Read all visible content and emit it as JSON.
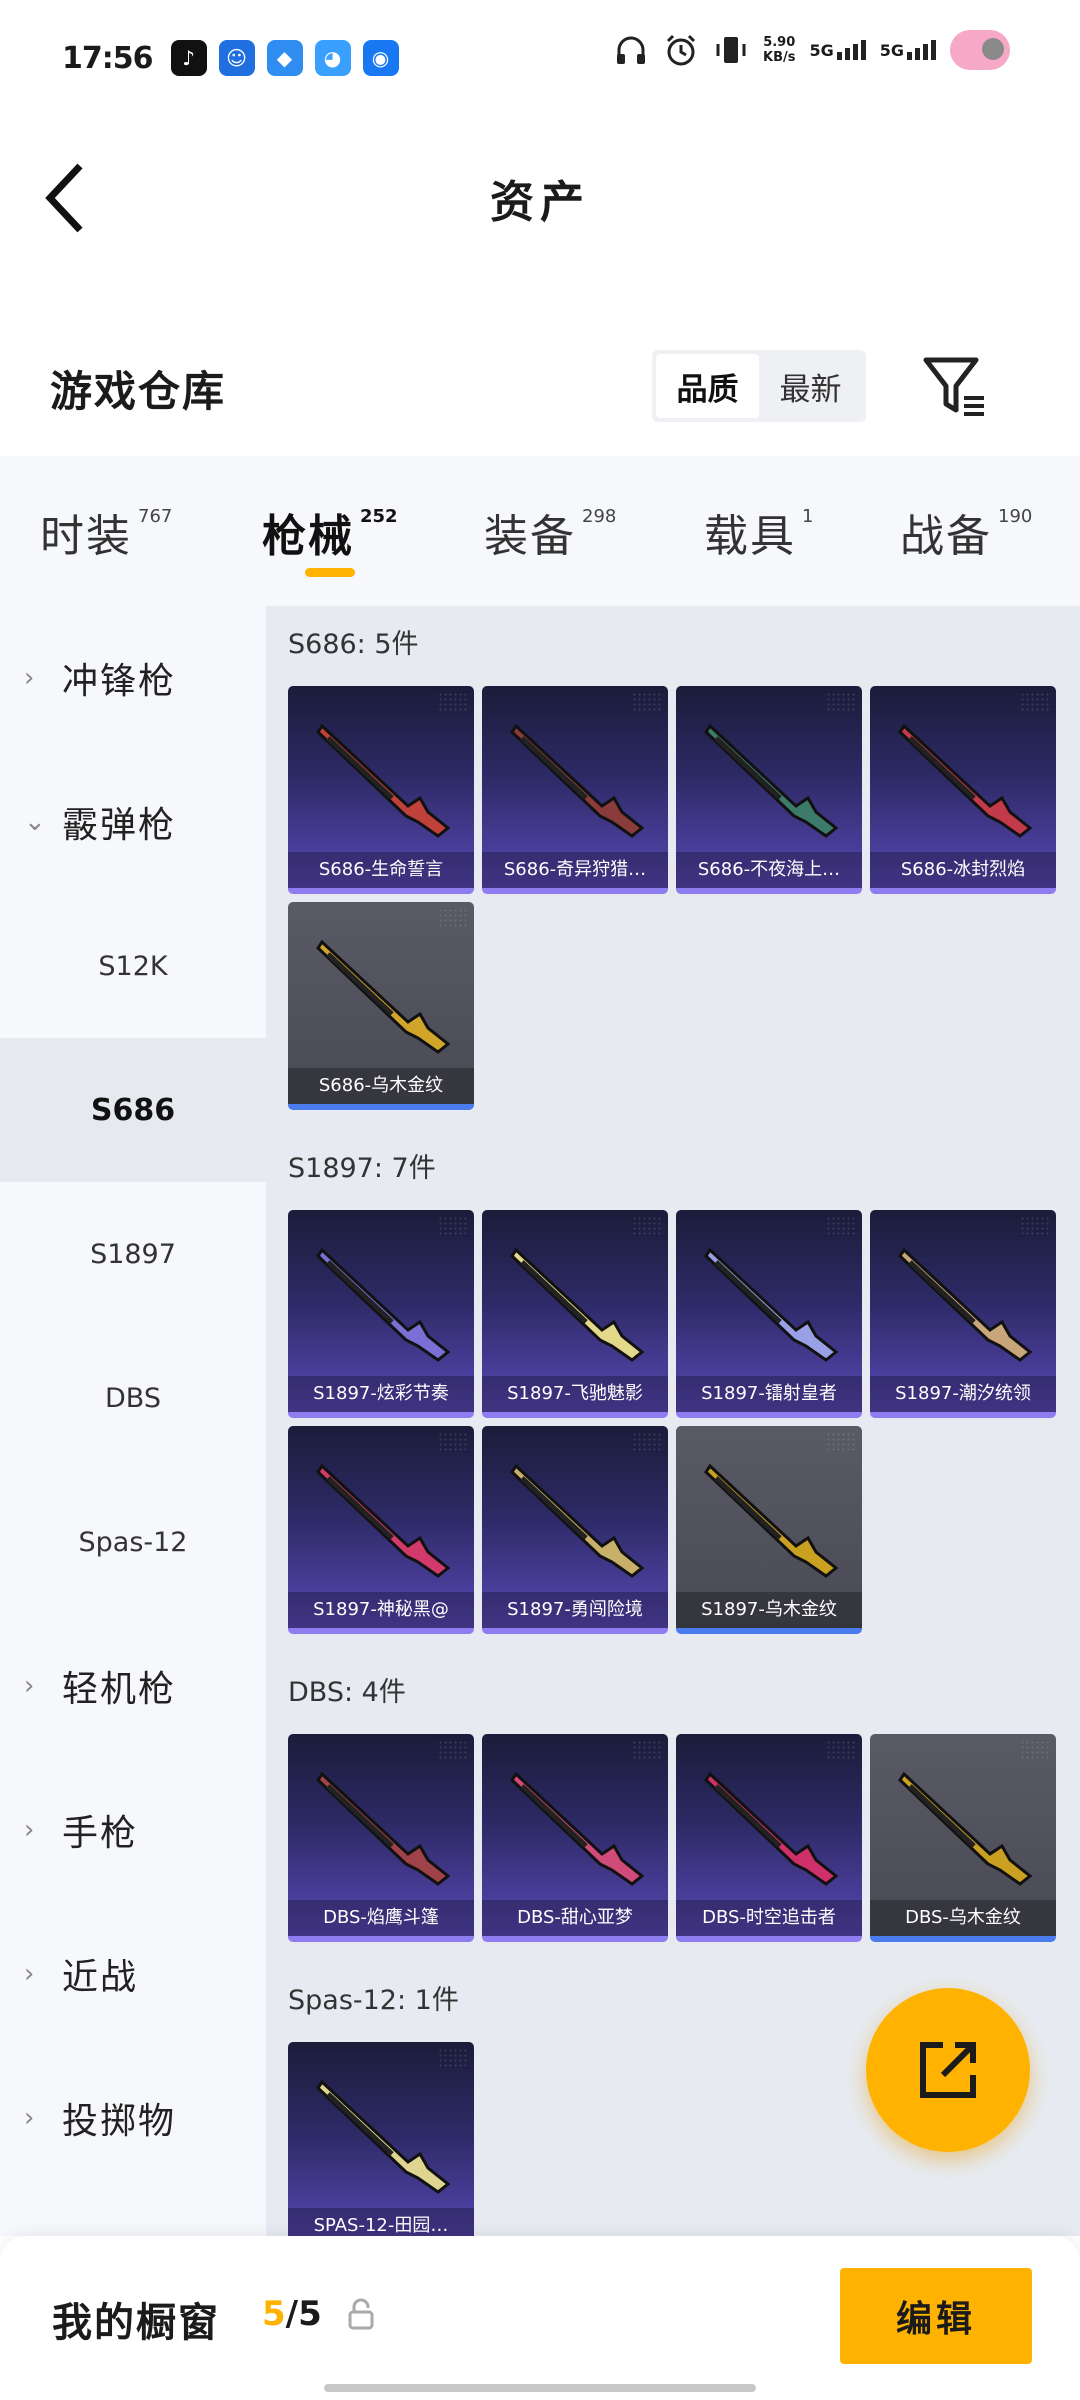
{
  "status_bar": {
    "time": "17:56",
    "net_speed_value": "5.90",
    "net_speed_unit": "KB/s",
    "sim1_label": "5G",
    "sim2_label": "5G",
    "app_icons": [
      "tiktok-icon",
      "app-icon-blue",
      "app-icon-cube",
      "app-icon-pie",
      "radio-app-icon"
    ],
    "system_icons": [
      "headphones-icon",
      "alarm-icon",
      "vibrate-icon"
    ]
  },
  "header": {
    "title": "资产"
  },
  "warehouse": {
    "title": "游戏仓库",
    "sort_options": [
      "品质",
      "最新"
    ],
    "active_sort": "品质"
  },
  "tabs": [
    {
      "label": "时装",
      "count": "767"
    },
    {
      "label": "枪械",
      "count": "252"
    },
    {
      "label": "装备",
      "count": "298"
    },
    {
      "label": "载具",
      "count": "1"
    },
    {
      "label": "战备",
      "count": "190"
    }
  ],
  "active_tab": "枪械",
  "side_menu": {
    "categories": [
      "冲锋枪",
      "霰弹枪",
      "轻机枪",
      "手枪",
      "近战",
      "投掷物"
    ],
    "expanded_category": "霰弹枪",
    "sub_items": [
      "S12K",
      "S686",
      "S1897",
      "DBS",
      "Spas-12"
    ],
    "active_sub_item": "S686"
  },
  "groups": [
    {
      "title": "S686: 5件",
      "items": [
        "S686-生命誓言",
        "S686-奇异狩猎…",
        "S686-不夜海上…",
        "S686-冰封烈焰",
        "S686-乌木金纹"
      ]
    },
    {
      "title": "S1897: 7件",
      "items": [
        "S1897-炫彩节奏",
        "S1897-飞驰魅影",
        "S1897-镭射皇者",
        "S1897-潮汐统领",
        "S1897-神秘黑@",
        "S1897-勇闯险境",
        "S1897-乌木金纹"
      ]
    },
    {
      "title": "DBS: 4件",
      "items": [
        "DBS-焰鹰斗篷",
        "DBS-甜心亚梦",
        "DBS-时空追击者",
        "DBS-乌木金纹"
      ]
    },
    {
      "title": "Spas-12: 1件",
      "items": [
        "SPAS-12-田园…"
      ]
    }
  ],
  "colors": {
    "accent": "#ffb300",
    "card_purple": "#5a48b6",
    "card_gold_bottom": "#4a7cf0"
  },
  "fab": {
    "icon": "share-external-icon"
  },
  "bottom_bar": {
    "label": "我的橱窗",
    "count_current": "5",
    "count_separator": "/",
    "count_total": "5",
    "edit_label": "编辑"
  }
}
